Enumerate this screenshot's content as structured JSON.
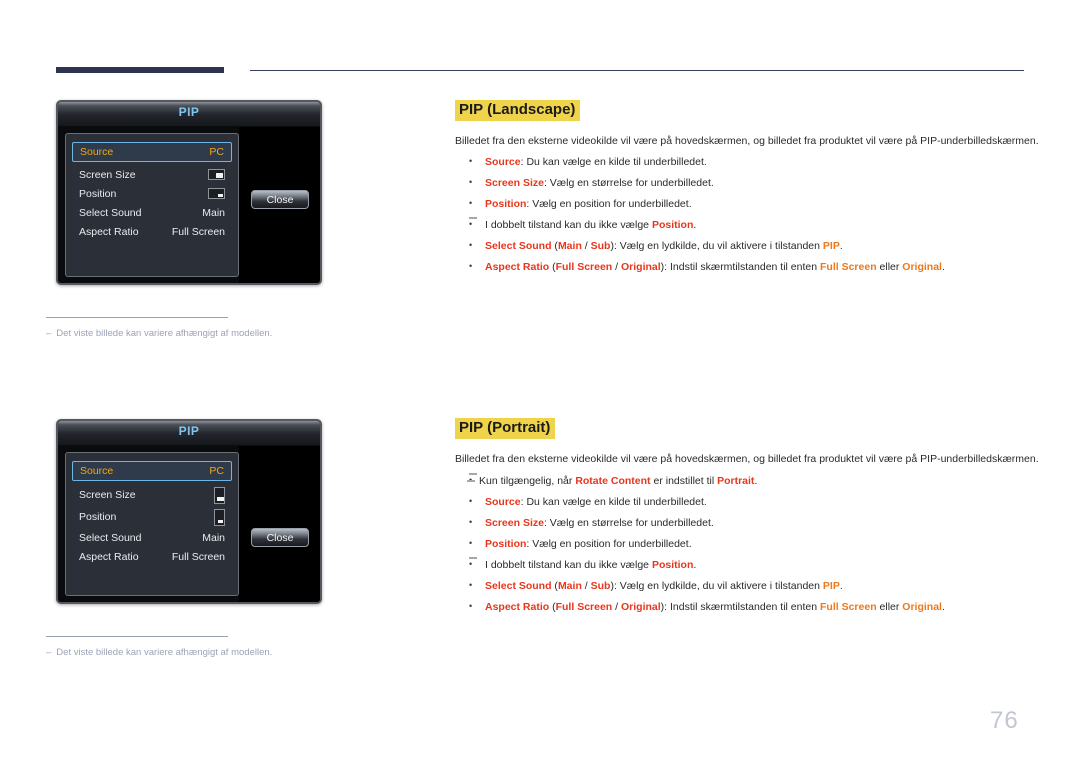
{
  "page": {
    "number": "76"
  },
  "osd": {
    "title": "PIP",
    "close_label": "Close",
    "landscape": {
      "rows": [
        {
          "label": "Source",
          "value": "PC",
          "type": "text",
          "selected": true
        },
        {
          "label": "Screen Size",
          "value": "",
          "type": "glyph-big"
        },
        {
          "label": "Position",
          "value": "",
          "type": "glyph-small"
        },
        {
          "label": "Select Sound",
          "value": "Main",
          "type": "text"
        },
        {
          "label": "Aspect Ratio",
          "value": "Full Screen",
          "type": "text"
        }
      ]
    },
    "portrait": {
      "rows": [
        {
          "label": "Source",
          "value": "PC",
          "type": "text",
          "selected": true
        },
        {
          "label": "Screen Size",
          "value": "",
          "type": "glyph-big"
        },
        {
          "label": "Position",
          "value": "",
          "type": "glyph-small"
        },
        {
          "label": "Select Sound",
          "value": "Main",
          "type": "text"
        },
        {
          "label": "Aspect Ratio",
          "value": "Full Screen",
          "type": "text"
        }
      ]
    }
  },
  "captions": {
    "first": "Det viste billede kan variere afhængigt af modellen.",
    "second": "Det viste billede kan variere afhængigt af modellen.",
    "dash": "–"
  },
  "sections": {
    "landscape": {
      "heading": "PIP (Landscape)",
      "intro": "Billedet fra den eksterne videokilde vil være på hovedskærmen, og billedet fra produktet vil være på PIP-underbilledskærmen.",
      "bullets": [
        {
          "kw": "Source",
          "rest": ": Du kan vælge en kilde til underbilledet."
        },
        {
          "kw": "Screen Size",
          "rest": ": Vælg en størrelse for underbilledet."
        },
        {
          "kw": "Position",
          "rest": ": Vælg en position for underbilledet."
        }
      ],
      "subnote": {
        "pre": "I dobbelt tilstand kan du ikke vælge ",
        "kw": "Position",
        "post": "."
      },
      "select_sound": {
        "kw": "Select Sound",
        "paren_open": " (",
        "opt1": "Main",
        "slash": " / ",
        "opt2": "Sub",
        "paren_close": ")",
        "rest": ": Vælg en lydkilde, du vil aktivere i tilstanden ",
        "end_kw": "PIP",
        "end": "."
      },
      "aspect_ratio": {
        "kw": "Aspect Ratio",
        "paren_open": " (",
        "opt1": "Full Screen",
        "slash": " / ",
        "opt2": "Original",
        "paren_close": ")",
        "rest": ": Indstil skærmtilstanden til enten ",
        "end_kw1": "Full Screen",
        "mid": " eller ",
        "end_kw2": "Original",
        "end": "."
      }
    },
    "portrait": {
      "heading": "PIP (Portrait)",
      "intro": "Billedet fra den eksterne videokilde vil være på hovedskærmen, og billedet fra produktet vil være på PIP-underbilledskærmen.",
      "topnote": {
        "pre": "Kun tilgængelig, når ",
        "kw1": "Rotate Content",
        "mid": " er indstillet til ",
        "kw2": "Portrait",
        "post": "."
      },
      "bullets": [
        {
          "kw": "Source",
          "rest": ": Du kan vælge en kilde til underbilledet."
        },
        {
          "kw": "Screen Size",
          "rest": ": Vælg en størrelse for underbilledet."
        },
        {
          "kw": "Position",
          "rest": ": Vælg en position for underbilledet."
        }
      ],
      "subnote": {
        "pre": "I dobbelt tilstand kan du ikke vælge ",
        "kw": "Position",
        "post": "."
      },
      "select_sound": {
        "kw": "Select Sound",
        "paren_open": " (",
        "opt1": "Main",
        "slash": " / ",
        "opt2": "Sub",
        "paren_close": ")",
        "rest": ": Vælg en lydkilde, du vil aktivere i tilstanden ",
        "end_kw": "PIP",
        "end": "."
      },
      "aspect_ratio": {
        "kw": "Aspect Ratio",
        "paren_open": " (",
        "opt1": "Full Screen",
        "slash": " / ",
        "opt2": "Original",
        "paren_close": ")",
        "rest": ": Indstil skærmtilstanden til enten ",
        "end_kw1": "Full Screen",
        "mid": " eller ",
        "end_kw2": "Original",
        "end": "."
      }
    }
  },
  "colors": {
    "highlight": "#efd34a",
    "keyword": "#e8361c",
    "keyword_orange": "#f07818",
    "osd_select": "#f0a818",
    "osd_title": "#7fc7f0",
    "rule": "#2f3352"
  }
}
